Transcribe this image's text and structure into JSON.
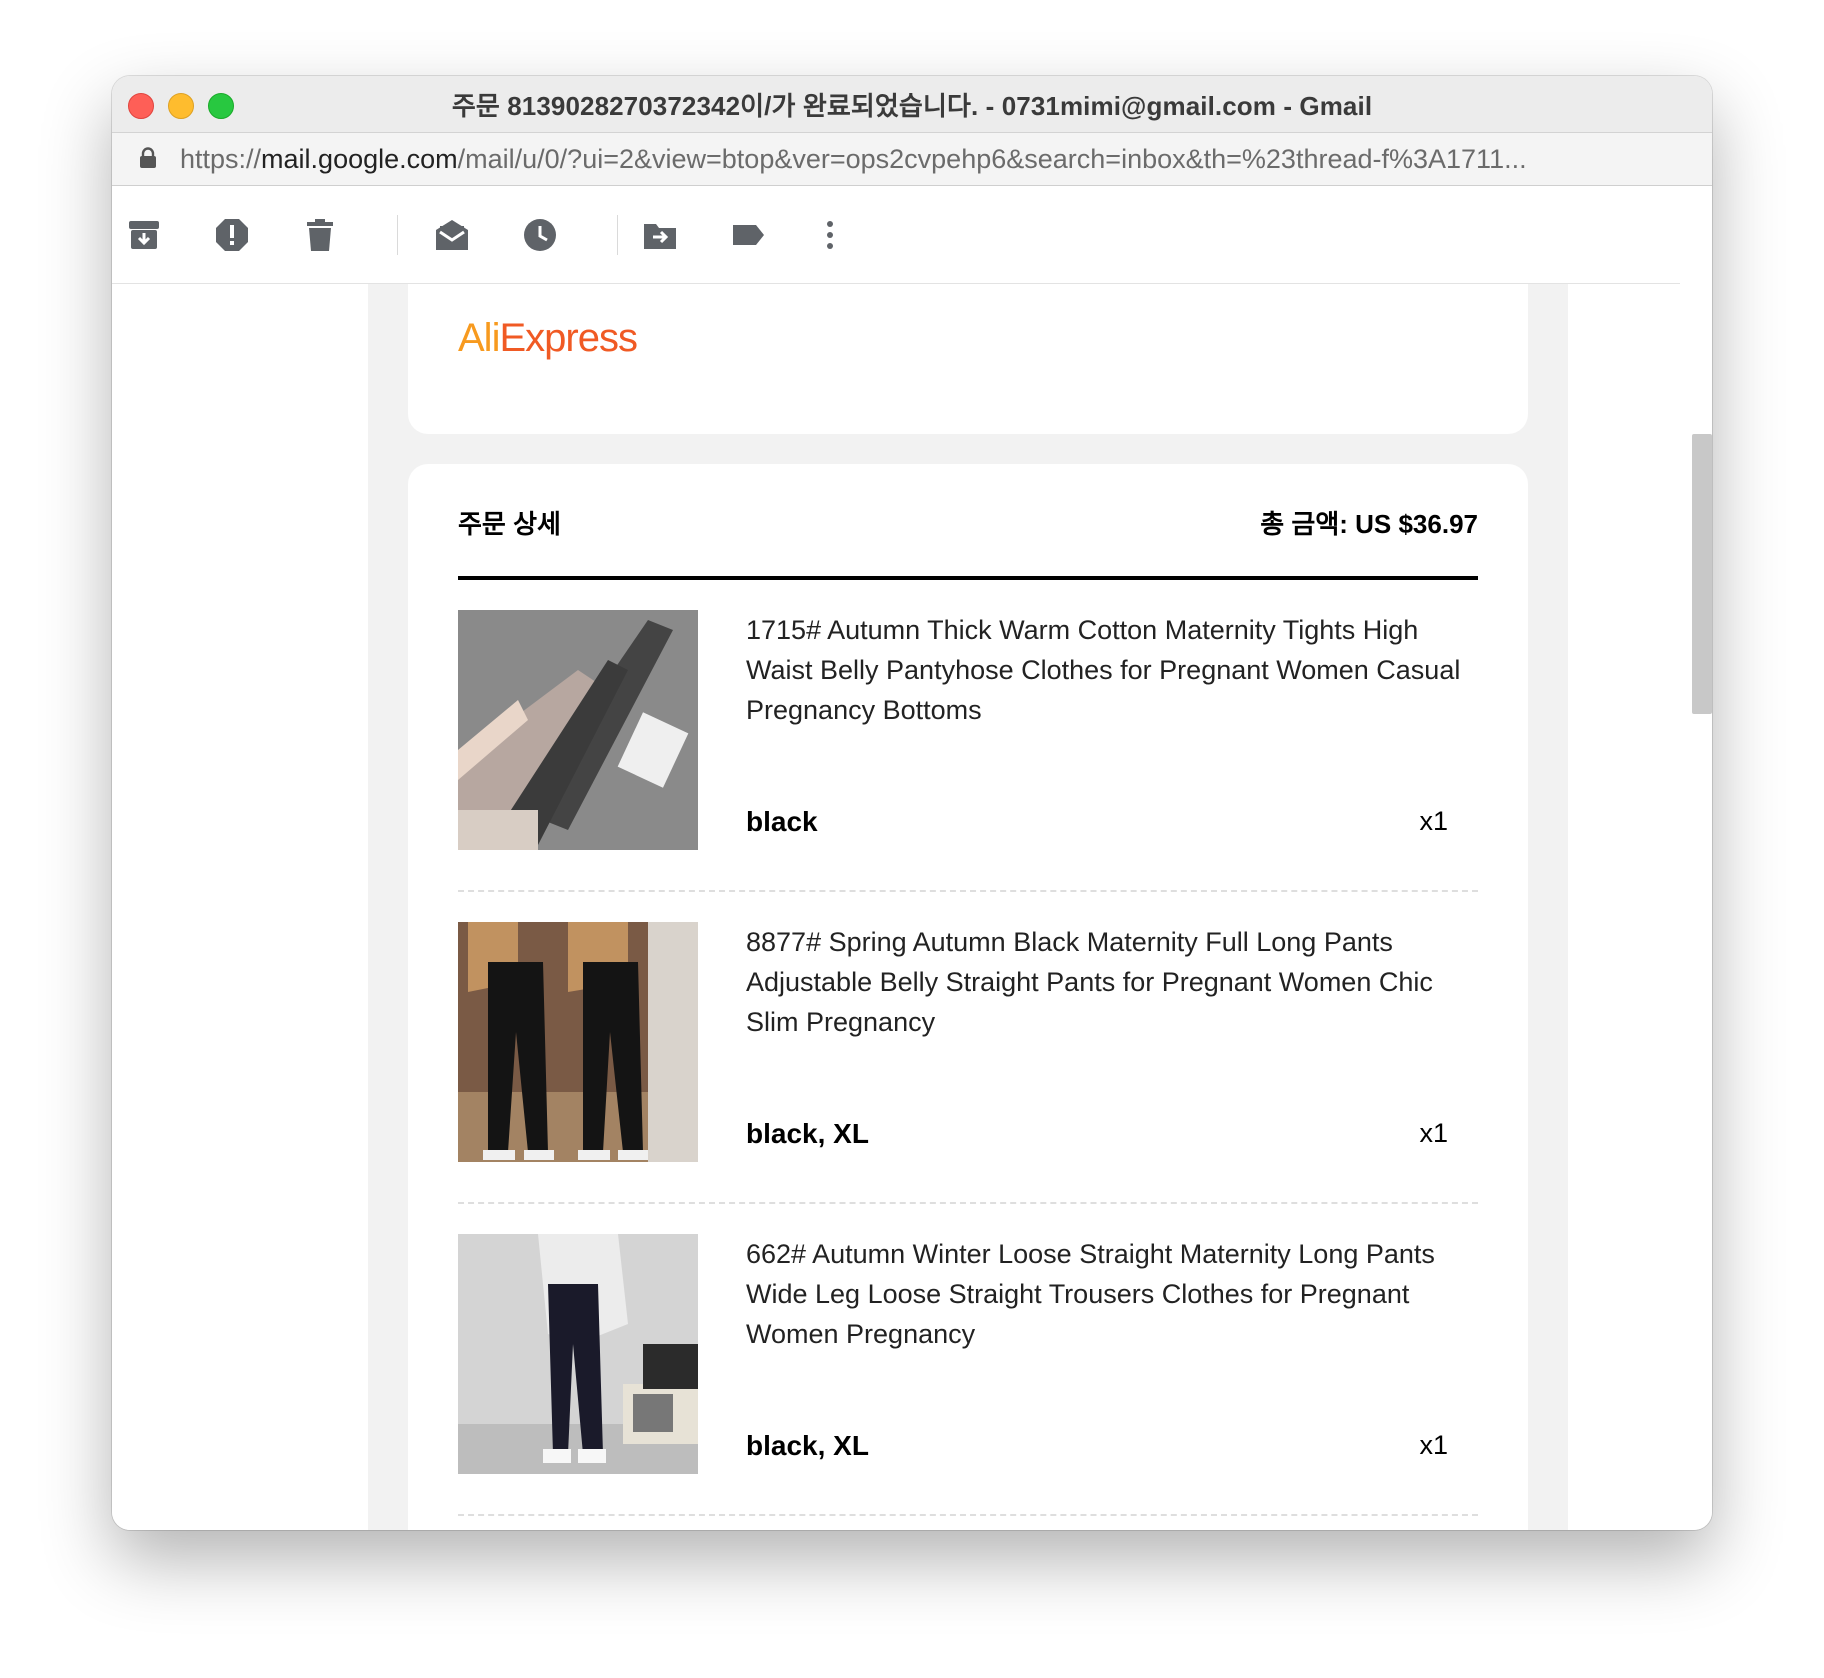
{
  "window": {
    "title": "주문 8139028270372342이/가 완료되었습니다. - 0731mimi@gmail.com - Gmail"
  },
  "address_bar": {
    "url_scheme": "https://",
    "url_host": "mail.google.com",
    "url_path": "/mail/u/0/?ui=2&view=btop&ver=ops2cvpehp6&search=inbox&th=%23thread-f%3A1711..."
  },
  "toolbar": {
    "icons": [
      "archive-icon",
      "report-spam-icon",
      "delete-icon",
      "mark-unread-icon",
      "snooze-icon",
      "move-to-icon",
      "label-icon",
      "more-options-icon"
    ]
  },
  "email": {
    "brand_logo": {
      "ali": "Ali",
      "express": "Express"
    },
    "order": {
      "title": "주문 상세",
      "total": "총 금액: US $36.97",
      "items": [
        {
          "name": "1715# Autumn Thick Warm Cotton Maternity Tights High Waist Belly Pantyhose Clothes for Pregnant Women Casual Pregnancy Bottoms",
          "variant": "black",
          "quantity": "x1"
        },
        {
          "name": "8877# Spring Autumn Black Maternity Full Long Pants Adjustable Belly Straight Pants for Pregnant Women Chic Slim Pregnancy",
          "variant": "black, XL",
          "quantity": "x1"
        },
        {
          "name": "662# Autumn Winter Loose Straight Maternity Long Pants Wide Leg Loose Straight Trousers Clothes for Pregnant Women Pregnancy",
          "variant": "black, XL",
          "quantity": "x1"
        }
      ]
    }
  },
  "colors": {
    "brand_orange": "#f05a24",
    "brand_yellow": "#f79a1f",
    "page_gray": "#f2f2f2"
  }
}
